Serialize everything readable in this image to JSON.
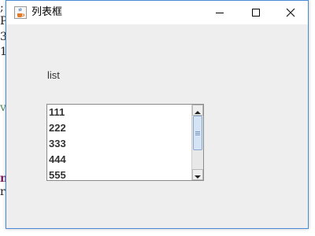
{
  "window": {
    "title": "列表框",
    "min_label": "minimize",
    "max_label": "maximize",
    "close_label": "close"
  },
  "content": {
    "label": "list",
    "list_items": [
      "111",
      "222",
      "333",
      "444",
      "555"
    ]
  },
  "background_fragments": [
    ";",
    "P,",
    "3",
    "1",
    "v",
    "n",
    "r"
  ],
  "colors": {
    "window_border": "#4a8bd6",
    "client_bg": "#eeeeee",
    "title_bg": "#ffffff",
    "scroll_thumb": "#d4e3f5"
  },
  "icons": {
    "app": "java-cup-icon",
    "minimize": "minimize-icon",
    "maximize": "maximize-icon",
    "close": "close-icon",
    "scroll_up": "arrow-up-icon",
    "scroll_down": "arrow-down-icon"
  }
}
